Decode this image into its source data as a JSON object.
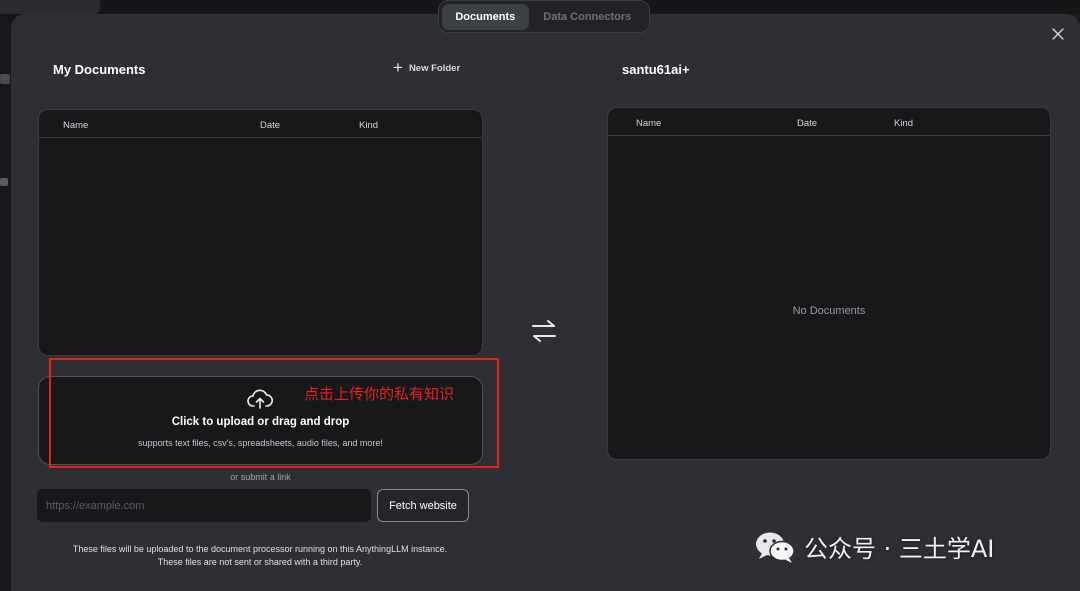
{
  "tabs": [
    {
      "label": "Documents",
      "active": true
    },
    {
      "label": "Data Connectors",
      "active": false
    }
  ],
  "left": {
    "title": "My Documents",
    "new_folder_label": "New Folder",
    "columns": [
      "Name",
      "Date",
      "Kind"
    ]
  },
  "right": {
    "title": "santu61ai+",
    "columns": [
      "Name",
      "Date",
      "Kind"
    ],
    "empty_text": "No Documents"
  },
  "upload": {
    "title": "Click to upload or drag and drop",
    "subtitle": "supports text files, csv's, spreadsheets, audio files, and more!",
    "annotation": "点击上传你的私有知识"
  },
  "link": {
    "or_text": "or submit a link",
    "placeholder": "https://example.com",
    "fetch_label": "Fetch website"
  },
  "footer": {
    "line1": "These files will be uploaded to the document processor running on this AnythingLLM instance.",
    "line2": "These files are not sent or shared with a third party."
  },
  "watermark": "公众号 · 三土学AI",
  "colors": {
    "modal_bg": "#2d2f34",
    "panel_bg": "#18181b",
    "annotation_red": "#e8221b"
  },
  "icons": [
    "close-icon",
    "plus-icon",
    "swap-arrows-icon",
    "cloud-upload-icon",
    "wechat-icon"
  ]
}
